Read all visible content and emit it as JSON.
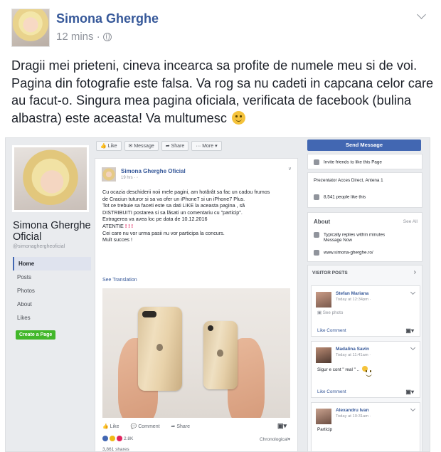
{
  "post": {
    "author": "Simona Gherghe",
    "time": "12 mins ·",
    "text": "Dragii mei prieteni, cineva incearca sa profite de numele meu si de voi. Pagina din fotografie este falsa. Va rog sa nu cadeti in capcana celor care au facut-o. Singura mea pagina oficiala, verificata de facebook (bulina albastra) este aceasta! Va multumesc"
  },
  "screenshot": {
    "page_name": "Simona Gherghe Oficial",
    "page_handle": "@simonaghergheoficial",
    "nav": [
      "Home",
      "Posts",
      "Photos",
      "About",
      "Likes"
    ],
    "create_page": "Create a Page",
    "actions": {
      "like": "Like",
      "message": "Message",
      "share": "Share",
      "more": "More ▾"
    },
    "send_message": "Send Message",
    "card": {
      "name": "Simona Gherghe Oficial",
      "time": "19 hrs · ",
      "lines": [
        "Cu ocazia deschiderii noii mele pagini, am hotărât sa fac un cadou frumos",
        "de Craciun tuturor si sa va ofer un iPhone7 si un iPhone7 Plus.",
        "Tot ce trebuie sa faceti este sa dati LIKE la aceasta pagina , să",
        "DISTRIBUITI postarea si sa lăsati un comentariu cu \"particip\".",
        "Extragerea va avea loc pe data de 10.12.2016",
        "ATENTIE",
        "Cei care nu vor urma pasii nu vor participa la concurs.",
        "Mult succes !"
      ],
      "attention_marks": "! ! !",
      "see_translation": "See Translation",
      "like": "Like",
      "comment": "Comment",
      "share": "Share",
      "reactions_count": "2.8K",
      "sort": "Chronological",
      "shares": "3,861 shares"
    },
    "right": {
      "invite": "Invite friends to like this Page",
      "category": "Prezentator Acces Direct, Antena 1",
      "likes": "8,541 people like this",
      "about_title": "About",
      "see_all": "See All",
      "response": [
        "Typically replies within minutes",
        "Message Now"
      ],
      "website": "www.simona-gherghe.ro/",
      "visitor_title": "VISITOR POSTS",
      "visitors": [
        {
          "name": "Stefan Mariana",
          "time": "Today at 12:34pm ·",
          "body": "See photo",
          "actions": "Like  Comment"
        },
        {
          "name": "Madalina Savin",
          "time": "Today at 11:41am ·",
          "body": "Sigur e cont \" real \" ..",
          "actions": "Like  Comment"
        },
        {
          "name": "Alexandru Ivan",
          "time": "Today at 10:31am ·",
          "body": "Particip",
          "actions": ""
        }
      ]
    }
  },
  "colors": {
    "link": "#365899",
    "accent": "#4267b2",
    "create": "#42b72a",
    "warning": "#e0245e"
  }
}
